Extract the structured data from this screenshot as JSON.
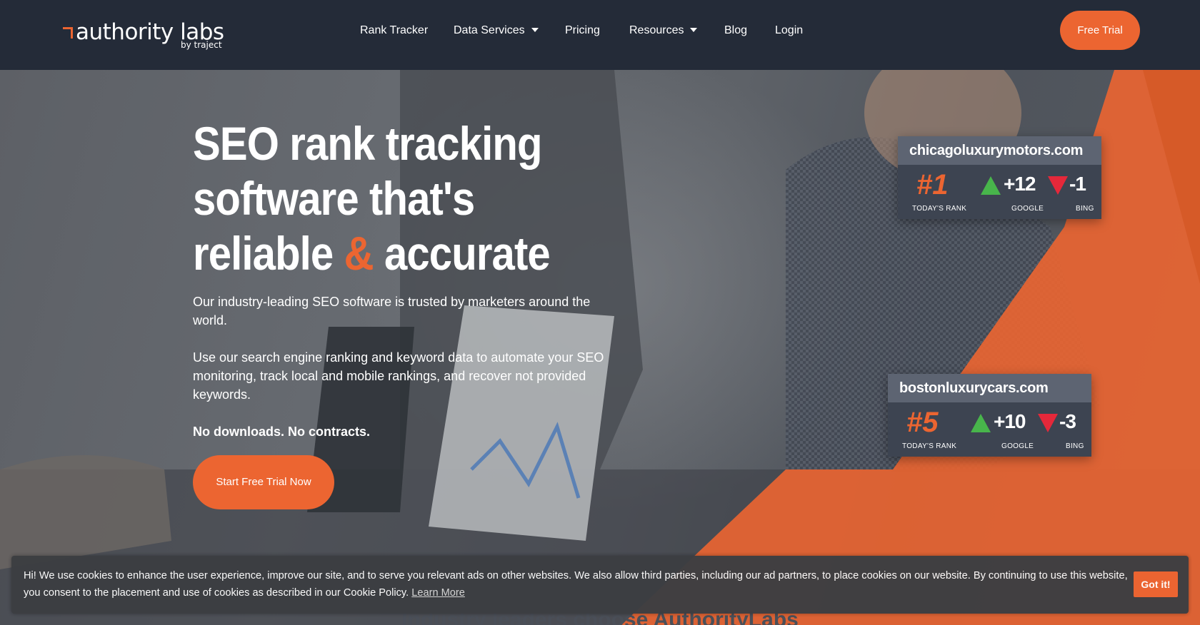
{
  "colors": {
    "accent": "#ec6531",
    "nav_bg": "#242b38",
    "up": "#48b54b",
    "down": "#e5283a"
  },
  "nav": {
    "logo_text": "authority labs",
    "logo_sub": "by traject",
    "items": [
      {
        "label": "Rank Tracker",
        "has_dropdown": false
      },
      {
        "label": "Data Services",
        "has_dropdown": true
      },
      {
        "label": "Pricing",
        "has_dropdown": false
      },
      {
        "label": "Resources",
        "has_dropdown": true
      },
      {
        "label": "Blog",
        "has_dropdown": false
      },
      {
        "label": "Login",
        "has_dropdown": false
      }
    ],
    "cta_label": "Free Trial"
  },
  "hero": {
    "headline_line1": "SEO rank tracking",
    "headline_line2": "software that's",
    "headline_line3_a": "reliable",
    "headline_amp": "&",
    "headline_line3_b": "accurate",
    "paragraph1": "Our industry-leading SEO software is trusted by marketers around the world.",
    "paragraph2": "Use our search engine ranking and keyword data to automate your SEO monitoring, track local and mobile rankings, and recover not provided keywords.",
    "strong_line": "No downloads. No contracts.",
    "cta_label": "Start Free Trial Now"
  },
  "rank_cards": [
    {
      "domain": "chicagoluxurymotors.com",
      "rank": "#1",
      "rank_label": "TODAY'S RANK",
      "google_change": "+12",
      "google_label": "GOOGLE",
      "bing_change": "-1",
      "bing_label": "BING"
    },
    {
      "domain": "bostonluxurycars.com",
      "rank": "#5",
      "rank_label": "TODAY'S RANK",
      "google_change": "+10",
      "google_label": "GOOGLE",
      "bing_change": "-3",
      "bing_label": "BING"
    }
  ],
  "cookie": {
    "text": "Hi! We use cookies to enhance the user experience, improve our site, and to serve you relevant ads on other websites. We also allow third parties, including our ad partners, to place cookies on our website. By continuing to use this website, you consent to the placement and use of cookies as described in our Cookie Policy.",
    "link_label": "Learn More",
    "button_label": "Got it!"
  },
  "next_section": {
    "heading": "Industry leaders choose AuthorityLabs"
  }
}
